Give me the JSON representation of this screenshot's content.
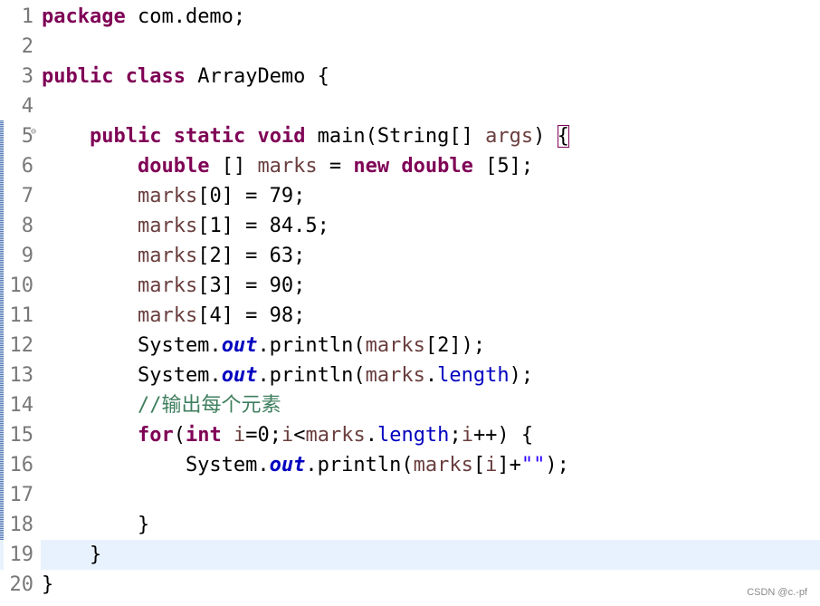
{
  "editor": {
    "lines": [
      {
        "number": "1",
        "segments": [
          {
            "t": "package",
            "c": "kw"
          },
          {
            "t": " com.demo;",
            "c": ""
          }
        ]
      },
      {
        "number": "2",
        "segments": []
      },
      {
        "number": "3",
        "segments": [
          {
            "t": "public",
            "c": "kw"
          },
          {
            "t": " ",
            "c": ""
          },
          {
            "t": "class",
            "c": "kw"
          },
          {
            "t": " ArrayDemo {",
            "c": ""
          }
        ]
      },
      {
        "number": "4",
        "segments": []
      },
      {
        "number": "5",
        "fold": "⊖",
        "segments": [
          {
            "t": "    ",
            "c": ""
          },
          {
            "t": "public",
            "c": "kw"
          },
          {
            "t": " ",
            "c": ""
          },
          {
            "t": "static",
            "c": "kw"
          },
          {
            "t": " ",
            "c": ""
          },
          {
            "t": "void",
            "c": "kw"
          },
          {
            "t": " main(String[] ",
            "c": ""
          },
          {
            "t": "args",
            "c": "var"
          },
          {
            "t": ") ",
            "c": ""
          },
          {
            "t": "{",
            "c": "brk"
          }
        ]
      },
      {
        "number": "6",
        "segments": [
          {
            "t": "        ",
            "c": ""
          },
          {
            "t": "double",
            "c": "kw"
          },
          {
            "t": " [] ",
            "c": ""
          },
          {
            "t": "marks",
            "c": "var"
          },
          {
            "t": " = ",
            "c": ""
          },
          {
            "t": "new",
            "c": "kw"
          },
          {
            "t": " ",
            "c": ""
          },
          {
            "t": "double",
            "c": "kw"
          },
          {
            "t": " [5];",
            "c": ""
          }
        ]
      },
      {
        "number": "7",
        "segments": [
          {
            "t": "        ",
            "c": ""
          },
          {
            "t": "marks",
            "c": "var"
          },
          {
            "t": "[0] = 79;",
            "c": ""
          }
        ]
      },
      {
        "number": "8",
        "segments": [
          {
            "t": "        ",
            "c": ""
          },
          {
            "t": "marks",
            "c": "var"
          },
          {
            "t": "[1] = 84.5;",
            "c": ""
          }
        ]
      },
      {
        "number": "9",
        "segments": [
          {
            "t": "        ",
            "c": ""
          },
          {
            "t": "marks",
            "c": "var"
          },
          {
            "t": "[2] = 63;",
            "c": ""
          }
        ]
      },
      {
        "number": "10",
        "segments": [
          {
            "t": "        ",
            "c": ""
          },
          {
            "t": "marks",
            "c": "var"
          },
          {
            "t": "[3] = 90;",
            "c": ""
          }
        ]
      },
      {
        "number": "11",
        "segments": [
          {
            "t": "        ",
            "c": ""
          },
          {
            "t": "marks",
            "c": "var"
          },
          {
            "t": "[4] = 98;",
            "c": ""
          }
        ]
      },
      {
        "number": "12",
        "segments": [
          {
            "t": "        System.",
            "c": ""
          },
          {
            "t": "out",
            "c": "sfld"
          },
          {
            "t": ".println(",
            "c": ""
          },
          {
            "t": "marks",
            "c": "var"
          },
          {
            "t": "[2]);",
            "c": ""
          }
        ]
      },
      {
        "number": "13",
        "segments": [
          {
            "t": "        System.",
            "c": ""
          },
          {
            "t": "out",
            "c": "sfld"
          },
          {
            "t": ".println(",
            "c": ""
          },
          {
            "t": "marks",
            "c": "var"
          },
          {
            "t": ".",
            "c": ""
          },
          {
            "t": "length",
            "c": "fld"
          },
          {
            "t": ");",
            "c": ""
          }
        ]
      },
      {
        "number": "14",
        "segments": [
          {
            "t": "        ",
            "c": ""
          },
          {
            "t": "//输出每个元素",
            "c": "cmt"
          }
        ]
      },
      {
        "number": "15",
        "segments": [
          {
            "t": "        ",
            "c": ""
          },
          {
            "t": "for",
            "c": "kw"
          },
          {
            "t": "(",
            "c": ""
          },
          {
            "t": "int",
            "c": "kw"
          },
          {
            "t": " ",
            "c": ""
          },
          {
            "t": "i",
            "c": "var"
          },
          {
            "t": "=0;",
            "c": ""
          },
          {
            "t": "i",
            "c": "var"
          },
          {
            "t": "<",
            "c": ""
          },
          {
            "t": "marks",
            "c": "var"
          },
          {
            "t": ".",
            "c": ""
          },
          {
            "t": "length",
            "c": "fld"
          },
          {
            "t": ";",
            "c": ""
          },
          {
            "t": "i",
            "c": "var"
          },
          {
            "t": "++) {",
            "c": ""
          }
        ]
      },
      {
        "number": "16",
        "segments": [
          {
            "t": "            System.",
            "c": ""
          },
          {
            "t": "out",
            "c": "sfld"
          },
          {
            "t": ".println(",
            "c": ""
          },
          {
            "t": "marks",
            "c": "var"
          },
          {
            "t": "[",
            "c": ""
          },
          {
            "t": "i",
            "c": "var"
          },
          {
            "t": "]+",
            "c": ""
          },
          {
            "t": "\"\"",
            "c": "str"
          },
          {
            "t": ");",
            "c": ""
          }
        ]
      },
      {
        "number": "17",
        "segments": []
      },
      {
        "number": "18",
        "segments": [
          {
            "t": "        }",
            "c": ""
          }
        ]
      },
      {
        "number": "19",
        "current": true,
        "segments": [
          {
            "t": "    }",
            "c": ""
          }
        ]
      },
      {
        "number": "20",
        "segments": [
          {
            "t": "}",
            "c": ""
          }
        ]
      }
    ]
  },
  "watermark": "CSDN @c.-pf",
  "colors": {
    "keyword": "#7f0055",
    "local_variable": "#6a3e3e",
    "field": "#0000c0",
    "comment": "#3f7f5f",
    "string": "#2a00ff",
    "line_number": "#787878",
    "current_line": "#e8f2fe"
  }
}
